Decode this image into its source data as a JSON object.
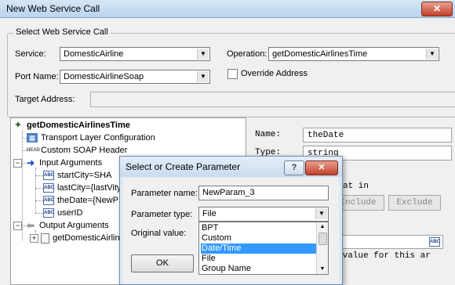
{
  "window": {
    "title": "New Web Service Call",
    "close_glyph": "✕"
  },
  "select_group": {
    "label": "Select Web Service Call",
    "service_label": "Service:",
    "service_value": "DomesticAirline",
    "port_label": "Port Name:",
    "port_value": "DomesticAirlineSoap",
    "operation_label": "Operation:",
    "operation_value": "getDomesticAirlinesTime",
    "override_label": "Override Address",
    "target_label": "Target Address:",
    "target_value": ""
  },
  "tree": {
    "root": "getDomesticAirlinesTime",
    "items": [
      {
        "label": "Transport Layer Configuration",
        "icon": "network-icon"
      },
      {
        "label": "Custom SOAP Header",
        "icon": "head-icon"
      },
      {
        "label": "Input Arguments",
        "icon": "arrow-right-icon"
      },
      {
        "label": "startCity=SHA",
        "icon": "abc-icon"
      },
      {
        "label": "lastCity={lastVity}",
        "icon": "abc-icon"
      },
      {
        "label": "theDate={NewP",
        "icon": "abc-icon"
      },
      {
        "label": "userID",
        "icon": "abc-icon"
      },
      {
        "label": "Output Arguments",
        "icon": "arrow-left-icon"
      },
      {
        "label": "getDomesticAirlin",
        "icon": "document-icon"
      }
    ],
    "abc_text": "ABC",
    "head_text": "HEAD",
    "expander_plus": "+",
    "expander_minus": "−"
  },
  "details": {
    "name_label": "Name:",
    "name_value": "theDate",
    "type_label": "Type:",
    "type_value": "string",
    "partial_text": "at in",
    "include_label": "Include",
    "exclude_label": "Exclude",
    "value_hint": "rvalue for this ar",
    "abc_text": "ABC"
  },
  "dialog": {
    "title": "Select or Create Parameter",
    "help_glyph": "?",
    "close_glyph": "✕",
    "param_name_label": "Parameter name:",
    "param_name_value": "NewParam_3",
    "param_type_label": "Parameter type:",
    "param_type_value": "File",
    "original_value_label": "Original value:",
    "type_options": [
      "BPT",
      "Custom",
      "Date/Time",
      "File",
      "Group Name"
    ],
    "selected_option": "Date/Time",
    "ok_label": "OK"
  },
  "colors": {
    "selection": "#3399ff",
    "title_bar": "#c9dbf0"
  }
}
